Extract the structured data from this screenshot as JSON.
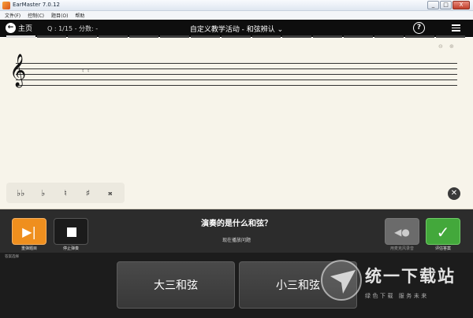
{
  "window": {
    "title": "EarMaster 7.0.12",
    "controls": [
      "_",
      "□",
      "X"
    ]
  },
  "menu": [
    "文件(F)",
    "控制(C)",
    "题目(O)",
    "帮助"
  ],
  "navbar": {
    "home_label": "主页",
    "home_icon": "back-arrow-icon",
    "question_info": "Q : 1/15 - 分数: -",
    "activity_title": "自定义教学活动 - 和弦辨认 ⌄",
    "help_label": "?",
    "menu_icon": "hamburger-icon",
    "progress": {
      "done": 1,
      "total": 15
    }
  },
  "score": {
    "clef": "𝄞",
    "chord_marks": "♮ ♮",
    "zoom_out": "⊖",
    "zoom_in": "⊕",
    "accidentals": [
      "♭♭",
      "♭",
      "♮",
      "♯",
      "𝄪"
    ],
    "clear_label": "✕"
  },
  "controls": {
    "replay_label": "重弹题目",
    "replay_symbol": "▶|",
    "stop_label": "停止弹奏",
    "question": "演奏的是什么和弦？",
    "status": "现在播放问题",
    "mic_label": "用麦克风录音",
    "mic_symbol": "◀●",
    "check_label": "评估答案",
    "check_symbol": "✓"
  },
  "answers": {
    "area_label": "答案选择",
    "options": [
      "大三和弦",
      "小三和弦"
    ]
  },
  "watermark": {
    "text": "统一下载站",
    "sub": "绿色下载 服务未来"
  },
  "colors": {
    "replay": "#ef8f1e",
    "check": "#43a83b",
    "navbar": "#0e0e0e",
    "score_bg": "#f7f4ea"
  }
}
